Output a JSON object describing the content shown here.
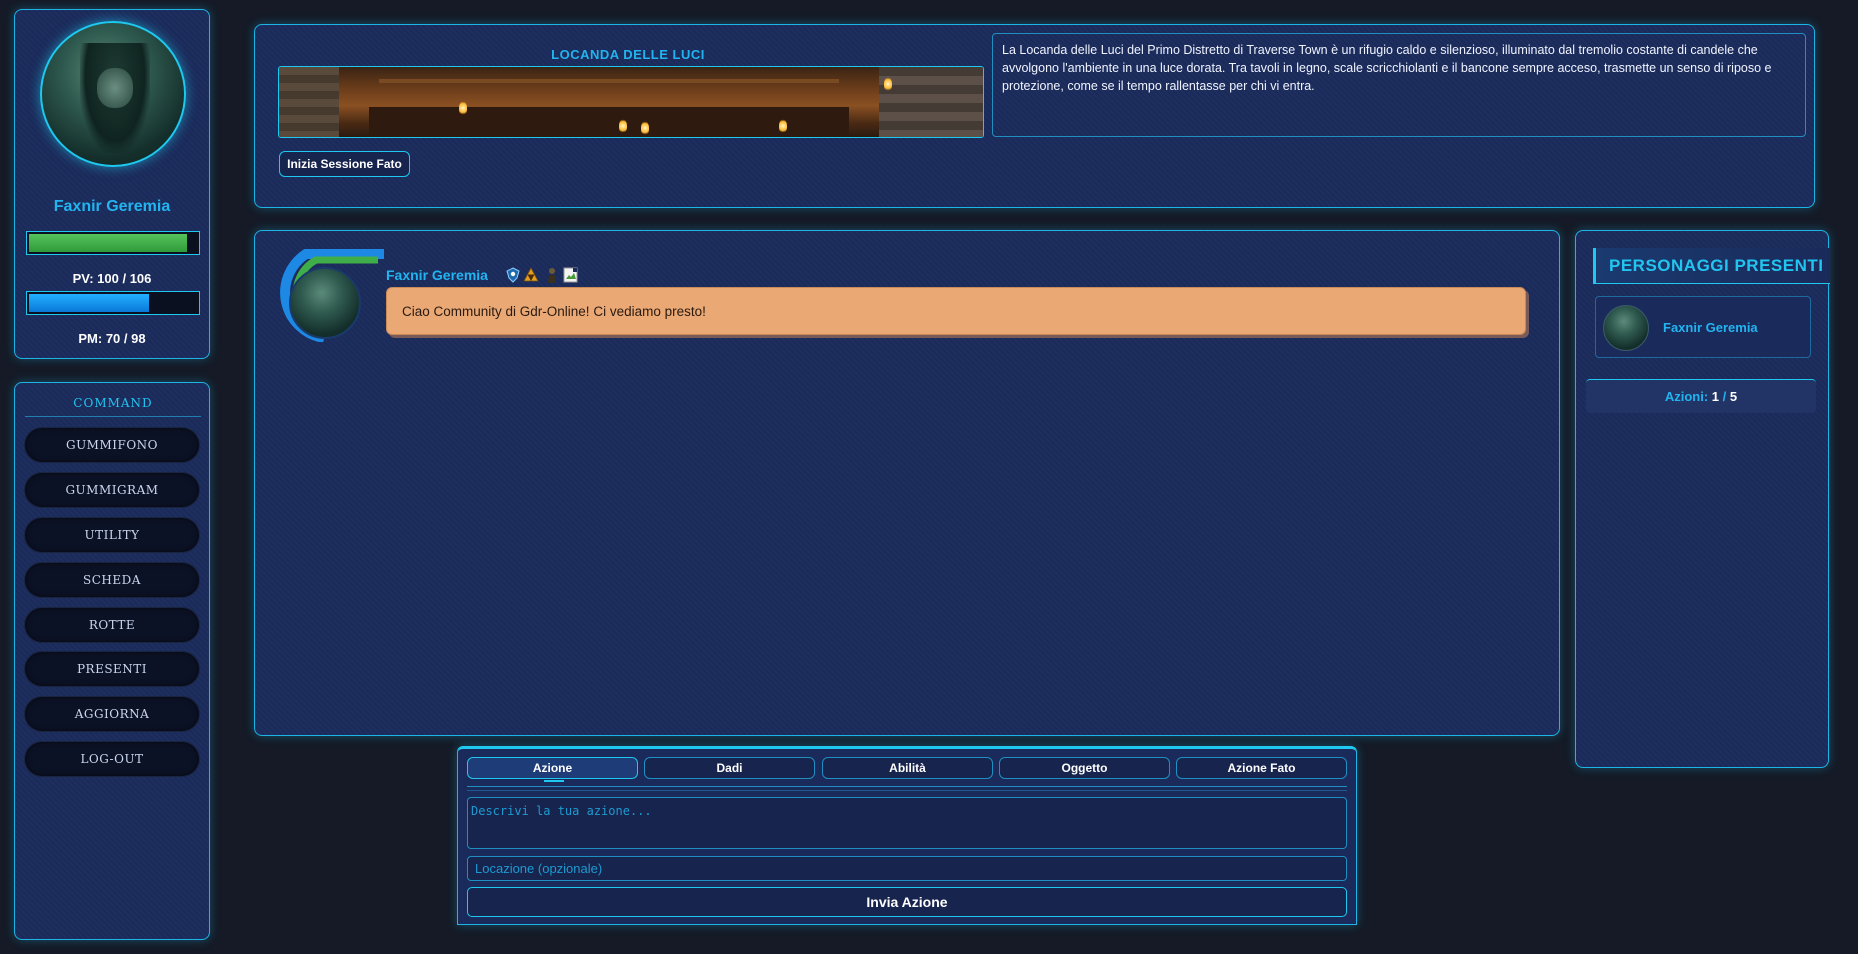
{
  "profile": {
    "name": "Faxnir Geremia",
    "hp": {
      "label": "PV: 100 / 106",
      "current": 100,
      "max": 106
    },
    "mp": {
      "label": "PM: 70 / 98",
      "current": 70,
      "max": 98
    }
  },
  "command": {
    "title": "COMMAND",
    "items": [
      "GUMMIFONO",
      "GUMMIGRAM",
      "UTILITY",
      "SCHEDA",
      "ROTTE",
      "PRESENTI",
      "AGGIORNA",
      "LOG-OUT"
    ]
  },
  "location": {
    "title": "LOCANDA DELLE LUCI",
    "description": "La Locanda delle Luci del Primo Distretto di Traverse Town è un rifugio caldo e silenzioso, illuminato dal tremolio costante di candele che avvolgono l'ambiente in una luce dorata. Tra tavoli in legno, scale scricchiolanti e il bancone sempre acceso, trasmette un senso di riposo e protezione, come se il tempo rallentasse per chi vi entra.",
    "fate_button": "Inizia Sessione Fato"
  },
  "chat": {
    "messages": [
      {
        "author": "Faxnir Geremia",
        "text": "Ciao Community di Gdr-Online! Ci vediamo presto!",
        "icons": [
          "shield-icon",
          "triforce-icon",
          "figure-icon",
          "broken-image-icon"
        ]
      }
    ]
  },
  "present": {
    "title": "PERSONAGGI PRESENTI",
    "characters": [
      {
        "name": "Faxnir Geremia"
      }
    ],
    "actions_label": "Azioni:",
    "actions_current": "1",
    "actions_sep": "/",
    "actions_max": "5"
  },
  "composer": {
    "tabs": [
      "Azione",
      "Dadi",
      "Abilità",
      "Oggetto",
      "Azione Fato"
    ],
    "active_tab": "Azione",
    "action_placeholder": "Descrivi la tua azione...",
    "location_placeholder": "Locazione (opzionale)",
    "send_label": "Invia Azione"
  },
  "colors": {
    "accent": "#1ec8ee",
    "name": "#22b4f0",
    "hp": "#3fae48",
    "mp": "#1496f0",
    "bubble": "#e9a874",
    "panel": "#1a2a5a",
    "background": "#151a26"
  }
}
